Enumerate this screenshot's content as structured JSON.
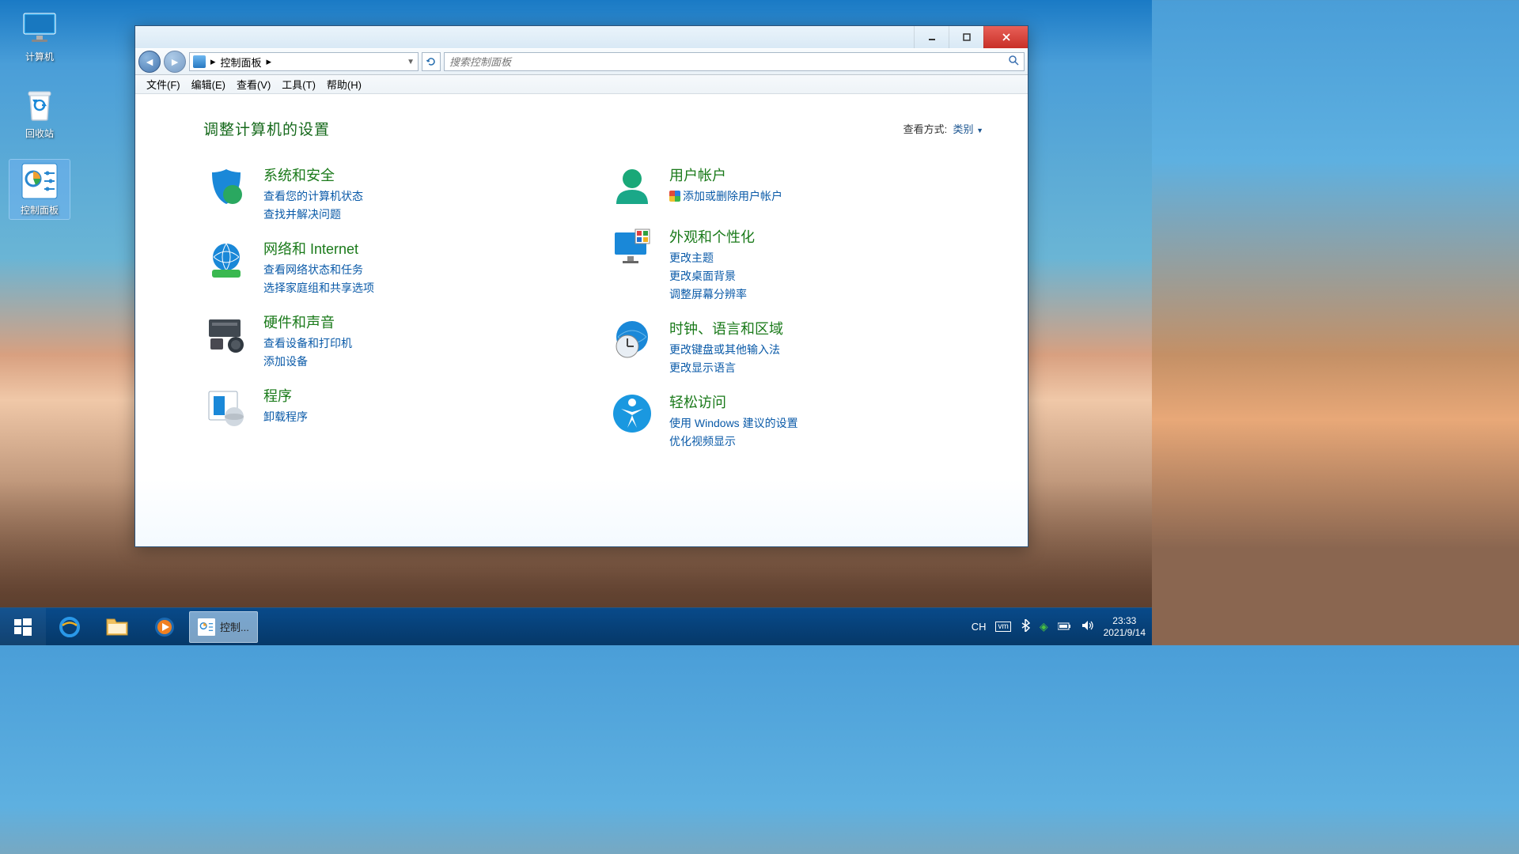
{
  "desktop": {
    "icons": [
      {
        "name": "computer",
        "label": "计算机"
      },
      {
        "name": "recycle",
        "label": "回收站"
      },
      {
        "name": "cpanel",
        "label": "控制面板"
      }
    ]
  },
  "window": {
    "breadcrumb_root": "控制面板",
    "search_placeholder": "搜索控制面板",
    "menubar": [
      "文件(F)",
      "编辑(E)",
      "查看(V)",
      "工具(T)",
      "帮助(H)"
    ],
    "heading": "调整计算机的设置",
    "viewby_label": "查看方式:",
    "viewby_value": "类别",
    "categories_left": [
      {
        "title": "系统和安全",
        "links": [
          "查看您的计算机状态",
          "查找并解决问题"
        ]
      },
      {
        "title": "网络和 Internet",
        "links": [
          "查看网络状态和任务",
          "选择家庭组和共享选项"
        ]
      },
      {
        "title": "硬件和声音",
        "links": [
          "查看设备和打印机",
          "添加设备"
        ]
      },
      {
        "title": "程序",
        "links": [
          "卸载程序"
        ]
      }
    ],
    "categories_right": [
      {
        "title": "用户帐户",
        "links": [
          "添加或删除用户帐户"
        ],
        "shield": [
          0
        ]
      },
      {
        "title": "外观和个性化",
        "links": [
          "更改主题",
          "更改桌面背景",
          "调整屏幕分辨率"
        ]
      },
      {
        "title": "时钟、语言和区域",
        "links": [
          "更改键盘或其他输入法",
          "更改显示语言"
        ]
      },
      {
        "title": "轻松访问",
        "links": [
          "使用 Windows 建议的设置",
          "优化视频显示"
        ]
      }
    ]
  },
  "taskbar": {
    "active_label": "控制...",
    "ime": "CH",
    "time": "23:33",
    "date": "2021/9/14"
  }
}
